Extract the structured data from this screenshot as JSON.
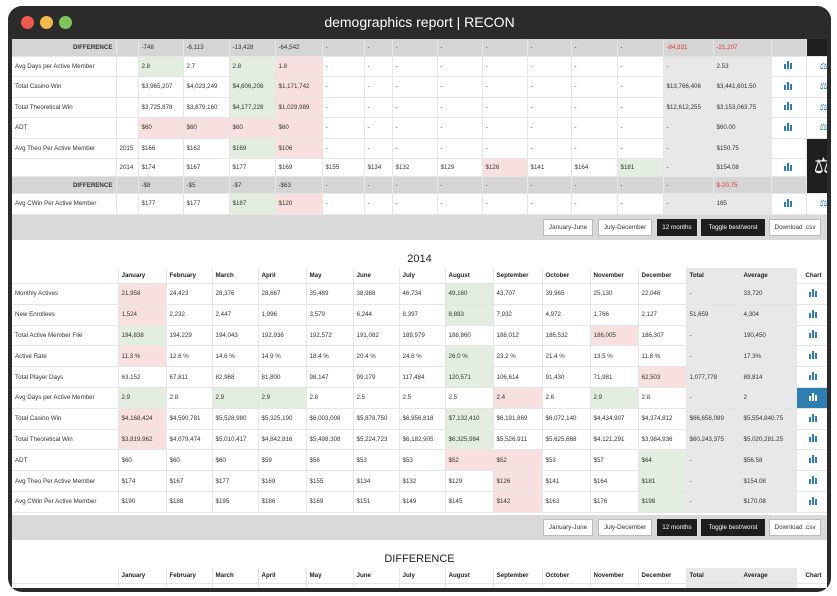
{
  "window": {
    "title": "demographics report | RECON"
  },
  "top_table": {
    "rows": [
      {
        "label": "DIFFERENCE",
        "year": "",
        "type": "diff",
        "cells": [
          "-748",
          "-6,113",
          "-13,428",
          "-64,542",
          "-",
          "-",
          "-",
          "-",
          "-",
          "-",
          "-",
          "-",
          "-84,831",
          "-21,207"
        ],
        "cls": [
          "",
          "",
          "",
          "",
          "",
          "",
          "",
          "",
          "",
          "",
          "",
          "",
          "redt",
          "redt"
        ],
        "chart": "",
        "extra": "black"
      },
      {
        "label": "Avg Days per Active Member",
        "year": "",
        "cells": [
          "2.8",
          "2.7",
          "2.8",
          "1.8",
          "-",
          "-",
          "-",
          "-",
          "-",
          "-",
          "-",
          "-",
          "-",
          "2.53"
        ],
        "cls": [
          "grn",
          "",
          "grn",
          "red",
          "",
          "",
          "",
          "",
          "",
          "",
          "",
          "",
          "gry",
          "gry"
        ],
        "chart": "bar",
        "extra": "balance"
      },
      {
        "label": "Total Casino Win",
        "year": "",
        "cells": [
          "$3,965,207",
          "$4,023,249",
          "$4,606,208",
          "$1,171,742",
          "-",
          "-",
          "-",
          "-",
          "-",
          "-",
          "-",
          "-",
          "$13,766,406",
          "$3,441,601.50"
        ],
        "cls": [
          "",
          "",
          "grn",
          "red",
          "",
          "",
          "",
          "",
          "",
          "",
          "",
          "",
          "gry",
          "gry"
        ],
        "chart": "bar",
        "extra": "balance"
      },
      {
        "label": "Total Theoretical Win",
        "year": "",
        "cells": [
          "$3,725,878",
          "$3,879,160",
          "$4,177,228",
          "$1,029,989",
          "-",
          "-",
          "-",
          "-",
          "-",
          "-",
          "-",
          "-",
          "$12,612,255",
          "$3,153,063.75"
        ],
        "cls": [
          "",
          "",
          "grn",
          "red",
          "",
          "",
          "",
          "",
          "",
          "",
          "",
          "",
          "gry",
          "gry"
        ],
        "chart": "bar",
        "extra": "balance"
      },
      {
        "label": "ADT",
        "year": "",
        "cells": [
          "$60",
          "$60",
          "$60",
          "$60",
          "-",
          "-",
          "-",
          "-",
          "-",
          "-",
          "-",
          "-",
          "-",
          "$60.00"
        ],
        "cls": [
          "red",
          "red",
          "red",
          "red",
          "",
          "",
          "",
          "",
          "",
          "",
          "",
          "",
          "gry",
          "gry"
        ],
        "chart": "bar",
        "extra": "balance"
      },
      {
        "label": "Avg Theo Per Active Member",
        "year": "2015",
        "cells": [
          "$166",
          "$162",
          "$169",
          "$106",
          "-",
          "-",
          "-",
          "-",
          "-",
          "-",
          "-",
          "-",
          "-",
          "$150.75"
        ],
        "cls": [
          "",
          "",
          "grn",
          "red",
          "",
          "",
          "",
          "",
          "",
          "",
          "",
          "",
          "gry",
          "gry"
        ],
        "chart": "",
        "extra": "black-balance-top"
      },
      {
        "label": "",
        "year": "2014",
        "type": "y2014",
        "cells": [
          "$174",
          "$167",
          "$177",
          "$169",
          "$155",
          "$134",
          "$132",
          "$129",
          "$126",
          "$141",
          "$164",
          "$181",
          "-",
          "$154.08"
        ],
        "cls": [
          "",
          "",
          "",
          "",
          "",
          "",
          "",
          "",
          "red",
          "",
          "",
          "grn",
          "gry",
          "gry"
        ],
        "chart": "bar",
        "extra": "black-balance"
      },
      {
        "label": "DIFFERENCE",
        "year": "",
        "type": "diff",
        "cells": [
          "-$8",
          "-$5",
          "-$7",
          "-$63",
          "-",
          "-",
          "-",
          "-",
          "-",
          "-",
          "-",
          "-",
          "-",
          "$-20.75"
        ],
        "cls": [
          "",
          "",
          "",
          "",
          "",
          "",
          "",
          "",
          "",
          "",
          "",
          "",
          "",
          "redt"
        ],
        "chart": "",
        "extra": "black-balance-bottom"
      },
      {
        "label": "Avg CWin Per Active Member",
        "year": "",
        "cells": [
          "$177",
          "$177",
          "$187",
          "$120",
          "-",
          "-",
          "-",
          "-",
          "-",
          "-",
          "-",
          "-",
          "-",
          "165"
        ],
        "cls": [
          "",
          "",
          "grn",
          "red",
          "",
          "",
          "",
          "",
          "",
          "",
          "",
          "",
          "gry",
          "gry"
        ],
        "chart": "bar",
        "extra": "balance"
      }
    ]
  },
  "buttons": [
    "January-June",
    "July-December",
    "12 months",
    "Toggle best/worst",
    "Download .csv"
  ],
  "section_2014": {
    "title": "2014",
    "headers": [
      "",
      "January",
      "February",
      "March",
      "April",
      "May",
      "June",
      "July",
      "August",
      "September",
      "October",
      "November",
      "December",
      "Total",
      "Average",
      "Chart"
    ],
    "rows": [
      {
        "label": "Monthly Actives",
        "cells": [
          "21,958",
          "24,423",
          "28,376",
          "28,667",
          "35,489",
          "38,988",
          "46,734",
          "49,160",
          "43,707",
          "39,965",
          "25,130",
          "22,046",
          "-",
          "33,720"
        ],
        "cls": [
          "red",
          "",
          "",
          "",
          "",
          "",
          "",
          "grn",
          "",
          "",
          "",
          "",
          "gry",
          "gry"
        ]
      },
      {
        "label": "New Enrollees",
        "cells": [
          "1,524",
          "2,232",
          "2,447",
          "1,996",
          "3,579",
          "6,244",
          "8,397",
          "8,883",
          "7,932",
          "4,972",
          "1,766",
          "2,127",
          "51,659",
          "4,304"
        ],
        "cls": [
          "red",
          "",
          "",
          "",
          "",
          "",
          "",
          "grn",
          "",
          "",
          "",
          "",
          "gry",
          "gry"
        ]
      },
      {
        "label": "Total Active Member File",
        "cells": [
          "194,838",
          "194,229",
          "194,043",
          "192,936",
          "192,572",
          "191,082",
          "189,979",
          "188,860",
          "188,012",
          "186,532",
          "186,005",
          "186,307",
          "-",
          "190,450"
        ],
        "cls": [
          "grn",
          "",
          "",
          "",
          "",
          "",
          "",
          "",
          "",
          "",
          "red",
          "",
          "gry",
          "gry"
        ]
      },
      {
        "label": "Active Rate",
        "cells": [
          "11.3 %",
          "12.6 %",
          "14.6 %",
          "14.9 %",
          "18.4 %",
          "20.4 %",
          "24.6 %",
          "26.0 %",
          "23.2 %",
          "21.4 %",
          "13.5 %",
          "11.8 %",
          "-",
          "17.3%"
        ],
        "cls": [
          "red",
          "",
          "",
          "",
          "",
          "",
          "",
          "grn",
          "",
          "",
          "",
          "",
          "gry",
          "gry"
        ]
      },
      {
        "label": "Total Player Days",
        "cells": [
          "63,152",
          "67,811",
          "82,968",
          "81,800",
          "98,147",
          "99,179",
          "117,484",
          "120,571",
          "106,614",
          "91,430",
          "71,981",
          "62,503",
          "1,077,778",
          "89,814"
        ],
        "cls": [
          "",
          "",
          "",
          "",
          "",
          "",
          "",
          "grn",
          "",
          "",
          "",
          "red",
          "gry",
          "gry"
        ]
      },
      {
        "label": "Avg Days per Active Member",
        "cells": [
          "2.9",
          "2.8",
          "2.9",
          "2.9",
          "2.8",
          "2.5",
          "2.5",
          "2.5",
          "2.4",
          "2.6",
          "2.9",
          "2.8",
          "-",
          "2"
        ],
        "cls": [
          "grn",
          "",
          "grn",
          "grn",
          "",
          "",
          "",
          "",
          "red",
          "",
          "grn",
          "",
          "gry",
          "gry"
        ],
        "hl": true
      },
      {
        "label": "Total Casino Win",
        "cells": [
          "$4,168,424",
          "$4,590,781",
          "$5,528,980",
          "$5,325,190",
          "$6,003,008",
          "$5,878,750",
          "$6,956,818",
          "$7,132,410",
          "$6,191,869",
          "$6,072,140",
          "$4,434,907",
          "$4,374,812",
          "$66,658,089",
          "$5,554,840.75"
        ],
        "cls": [
          "red",
          "",
          "",
          "",
          "",
          "",
          "",
          "grn",
          "",
          "",
          "",
          "",
          "gry",
          "gry"
        ]
      },
      {
        "label": "Total Theoretical Win",
        "cells": [
          "$3,819,962",
          "$4,079,474",
          "$5,010,417",
          "$4,842,816",
          "$5,498,308",
          "$5,224,723",
          "$6,182,905",
          "$6,325,984",
          "$5,526,911",
          "$5,625,668",
          "$4,121,291",
          "$3,984,936",
          "$60,243,375",
          "$5,020,281.25"
        ],
        "cls": [
          "red",
          "",
          "",
          "",
          "",
          "",
          "",
          "grn",
          "",
          "",
          "",
          "",
          "gry",
          "gry"
        ]
      },
      {
        "label": "ADT",
        "cells": [
          "$60",
          "$60",
          "$60",
          "$59",
          "$56",
          "$53",
          "$53",
          "$52",
          "$52",
          "$53",
          "$57",
          "$64",
          "-",
          "$56.58"
        ],
        "cls": [
          "",
          "",
          "",
          "",
          "",
          "",
          "",
          "red",
          "red",
          "",
          "",
          "grn",
          "gry",
          "gry"
        ]
      },
      {
        "label": "Avg Theo Per Active Member",
        "cells": [
          "$174",
          "$167",
          "$177",
          "$169",
          "$155",
          "$134",
          "$132",
          "$129",
          "$126",
          "$141",
          "$164",
          "$181",
          "-",
          "$154.08"
        ],
        "cls": [
          "",
          "",
          "",
          "",
          "",
          "",
          "",
          "",
          "red",
          "",
          "",
          "grn",
          "gry",
          "gry"
        ]
      },
      {
        "label": "Avg CWin Per Active Member",
        "cells": [
          "$190",
          "$188",
          "$195",
          "$186",
          "$169",
          "$151",
          "$149",
          "$145",
          "$142",
          "$163",
          "$176",
          "$198",
          "-",
          "$170.08"
        ],
        "cls": [
          "",
          "",
          "",
          "",
          "",
          "",
          "",
          "",
          "red",
          "",
          "",
          "grn",
          "gry",
          "gry"
        ]
      }
    ]
  },
  "section_diff": {
    "title": "DIFFERENCE",
    "headers": [
      "",
      "January",
      "February",
      "March",
      "April",
      "May",
      "June",
      "July",
      "August",
      "September",
      "October",
      "November",
      "December",
      "Total",
      "Average",
      "Chart"
    ]
  }
}
